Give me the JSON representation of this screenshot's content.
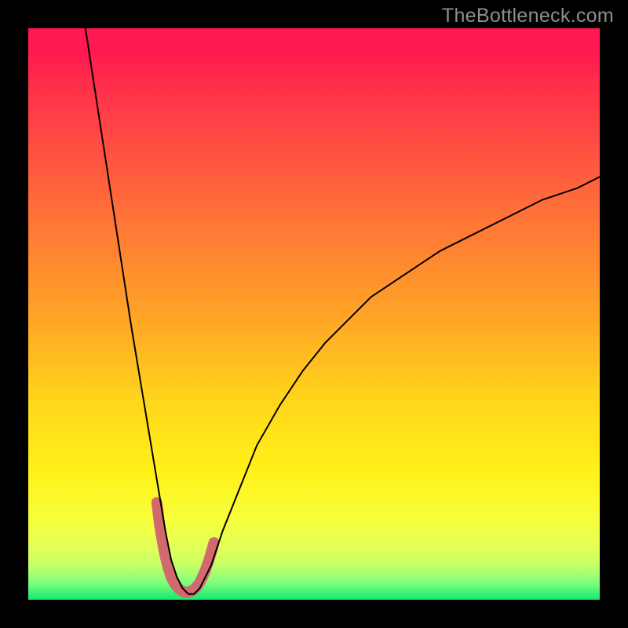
{
  "watermark": "TheBottleneck.com",
  "chart_data": {
    "type": "line",
    "title": "",
    "xlabel": "",
    "ylabel": "",
    "xlim": [
      0,
      100
    ],
    "ylim": [
      0,
      100
    ],
    "series": [
      {
        "name": "bottleneck-curve",
        "x": [
          10,
          12,
          14,
          16,
          18,
          20,
          21,
          22,
          23,
          24,
          25,
          26,
          27,
          28,
          29,
          30,
          31,
          32,
          33,
          34,
          36,
          38,
          40,
          44,
          48,
          52,
          56,
          60,
          66,
          72,
          78,
          84,
          90,
          96,
          100
        ],
        "y": [
          100,
          87,
          74,
          61,
          48,
          36,
          30,
          24,
          18,
          12,
          7,
          4,
          2,
          1,
          1,
          2,
          4,
          6,
          9,
          12,
          17,
          22,
          27,
          34,
          40,
          45,
          49,
          53,
          57,
          61,
          64,
          67,
          70,
          72,
          74
        ],
        "color": "#000000",
        "width": 2
      },
      {
        "name": "valley-highlight",
        "x": [
          22.5,
          23,
          23.5,
          24,
          24.5,
          25,
          25.5,
          26,
          26.5,
          27,
          27.5,
          28,
          28.5,
          29,
          29.5,
          30,
          30.5,
          31,
          31.5,
          32,
          32.5
        ],
        "y": [
          17,
          13,
          10,
          7.5,
          5.5,
          4,
          3,
          2.3,
          1.8,
          1.5,
          1.3,
          1.3,
          1.5,
          1.8,
          2.3,
          3,
          4,
          5.2,
          6.6,
          8.2,
          10
        ],
        "color": "#d16a6e",
        "width": 14
      }
    ],
    "gradient_stops": [
      {
        "pos": 0.0,
        "color": "#ff1950"
      },
      {
        "pos": 0.3,
        "color": "#ff6a3a"
      },
      {
        "pos": 0.5,
        "color": "#ffa326"
      },
      {
        "pos": 0.78,
        "color": "#fff21a"
      },
      {
        "pos": 1.0,
        "color": "#14e872"
      }
    ]
  }
}
